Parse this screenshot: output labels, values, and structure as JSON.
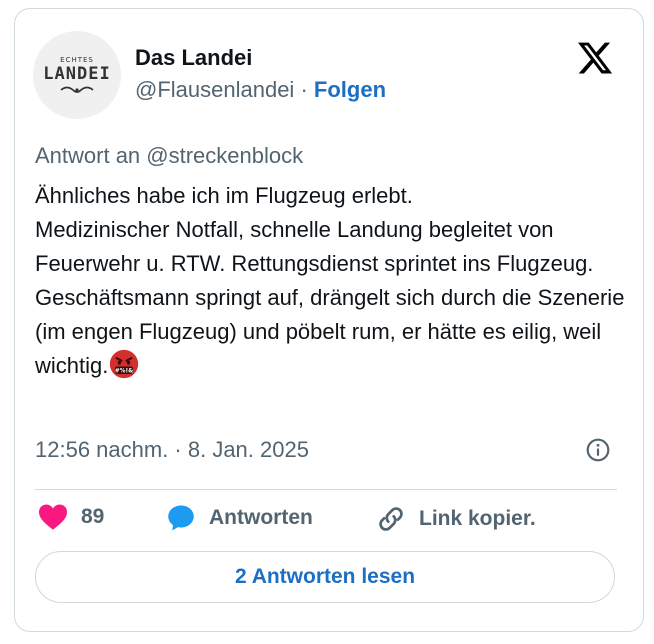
{
  "author": {
    "display_name": "Das Landei",
    "handle": "@Flausenlandei",
    "separator": "·",
    "follow_label": "Folgen",
    "avatar": {
      "top_text": "ECHTES",
      "main_text": "LANDEI"
    }
  },
  "platform_icon": "x-logo-icon",
  "reply_to": "Antwort an @streckenblock",
  "tweet": {
    "text": "Ähnliches habe ich im Flugzeug erlebt.\nMedizinischer Notfall, schnelle Landung begleitet von Feuerwehr u. RTW. Rettungsdienst sprintet ins Flugzeug. Geschäftsmann springt auf, drängelt sich durch die Szenerie (im engen Flugzeug) und pöbelt rum, er hätte es eilig, weil wichtig.",
    "emoji": "face-with-symbols-on-mouth-icon",
    "timestamp": "12:56 nachm. · 8. Jan. 2025"
  },
  "actions": {
    "like_count": "89",
    "reply_label": "Antworten",
    "copy_link_label": "Link kopier."
  },
  "read_replies_label": "2 Antworten lesen",
  "colors": {
    "link_blue": "#1d6fc4",
    "heart_pink": "#f91880",
    "reply_blue": "#1d9bf0",
    "secondary_text": "#536471",
    "border": "#cfd9de",
    "emoji_red": "#d32f2f"
  }
}
